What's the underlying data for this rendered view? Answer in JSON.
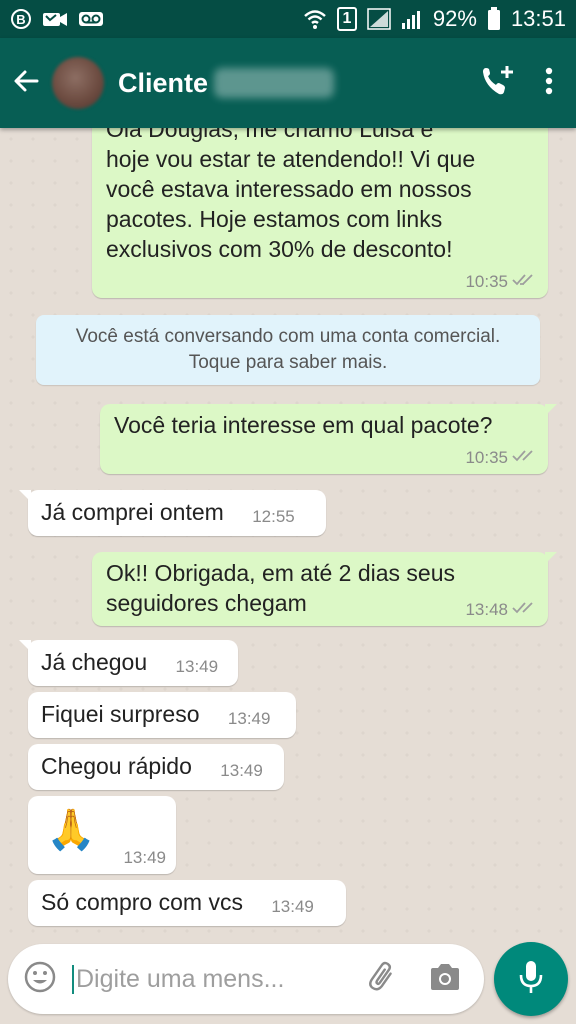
{
  "status_bar": {
    "battery": "92%",
    "time": "13:51",
    "sim_label": "1",
    "icons": [
      "b-badge-icon",
      "missed-video-icon",
      "voicemail-icon",
      "wifi-icon",
      "sim-icon",
      "signal-icon",
      "battery-icon"
    ]
  },
  "header": {
    "contact_name": "Cliente",
    "icons": [
      "back-arrow-icon",
      "add-call-icon",
      "more-vert-icon"
    ]
  },
  "messages": [
    {
      "direction": "out",
      "lines": [
        "Olá Douglas, me chamo Luisa e",
        "hoje vou estar te atendendo!! Vi que",
        "você estava interessado em nossos",
        "pacotes. Hoje estamos com links",
        "exclusivos com 30% de desconto!"
      ],
      "time": "10:35",
      "ticks": "double-check-icon"
    },
    {
      "direction": "out",
      "lines": [
        "Você teria interesse em qual pacote?"
      ],
      "time": "10:35",
      "ticks": "double-check-icon"
    },
    {
      "direction": "in",
      "text": "Já comprei ontem",
      "time": "12:55"
    },
    {
      "direction": "out",
      "lines": [
        "Ok!! Obrigada, em até 2 dias seus",
        "seguidores chegam"
      ],
      "time": "13:48",
      "ticks": "double-check-icon"
    },
    {
      "direction": "in",
      "text": "Já chegou",
      "time": "13:49"
    },
    {
      "direction": "in",
      "text": "Fiquei surpreso",
      "time": "13:49"
    },
    {
      "direction": "in",
      "text": "Chegou rápido",
      "time": "13:49"
    },
    {
      "direction": "in",
      "emoji": "🙏",
      "time": "13:49"
    },
    {
      "direction": "in",
      "text": "Só compro com vcs",
      "time": "13:49"
    }
  ],
  "system_notice": {
    "line1": "Você está conversando com uma conta comercial.",
    "line2": "Toque para saber mais."
  },
  "input": {
    "placeholder": "Digite uma mens...",
    "icons": [
      "emoji-icon",
      "attach-icon",
      "camera-icon",
      "mic-icon"
    ]
  },
  "colors": {
    "appbar": "#075e54",
    "statusbar": "#054d44",
    "outgoing_bubble": "#dcf8c6",
    "incoming_bubble": "#ffffff",
    "chat_background": "#e5ddd5",
    "system_notice": "#e1f3fb",
    "mic_button": "#00897b"
  }
}
